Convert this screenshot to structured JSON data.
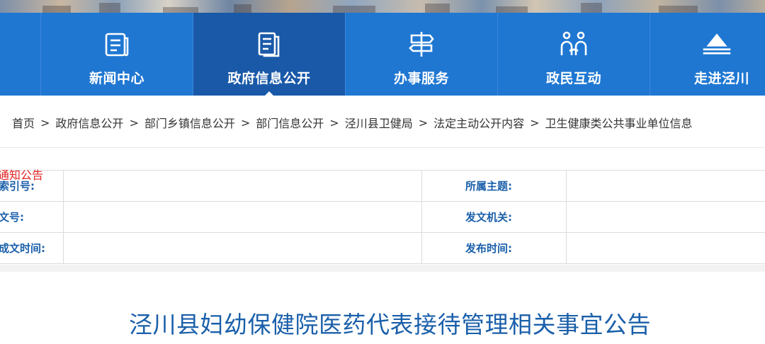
{
  "nav": {
    "items": [
      {
        "label": "新闻中心",
        "icon": "newspaper-icon",
        "active": false
      },
      {
        "label": "政府信息公开",
        "icon": "document-list-icon",
        "active": true
      },
      {
        "label": "办事服务",
        "icon": "signpost-icon",
        "active": false
      },
      {
        "label": "政民互动",
        "icon": "people-icon",
        "active": false
      },
      {
        "label": "走进泾川",
        "icon": "mountain-icon",
        "active": false
      }
    ]
  },
  "breadcrumb": {
    "items": [
      "首页",
      "政府信息公开",
      "部门乡镇信息公开",
      "部门信息公开",
      "泾川县卫健局",
      "法定主动公开内容",
      "卫生健康类公共事业单位信息"
    ],
    "separator": ">"
  },
  "info": {
    "tag": "通知公告",
    "rows": [
      {
        "left_label": "索引号:",
        "left_value": "",
        "right_label": "所属主题:",
        "right_value": ""
      },
      {
        "left_label": "文号:",
        "left_value": "",
        "right_label": "发文机关:",
        "right_value": ""
      },
      {
        "left_label": "成文时间:",
        "left_value": "",
        "right_label": "发布时间:",
        "right_value": ""
      }
    ]
  },
  "article": {
    "title": "泾川县妇幼保健院医药代表接待管理相关事宜公告"
  },
  "colors": {
    "nav_bg": "#1f77d2",
    "nav_active_bg": "#1959a8",
    "label_blue": "#1a5faa",
    "tag_red": "#e02424"
  }
}
